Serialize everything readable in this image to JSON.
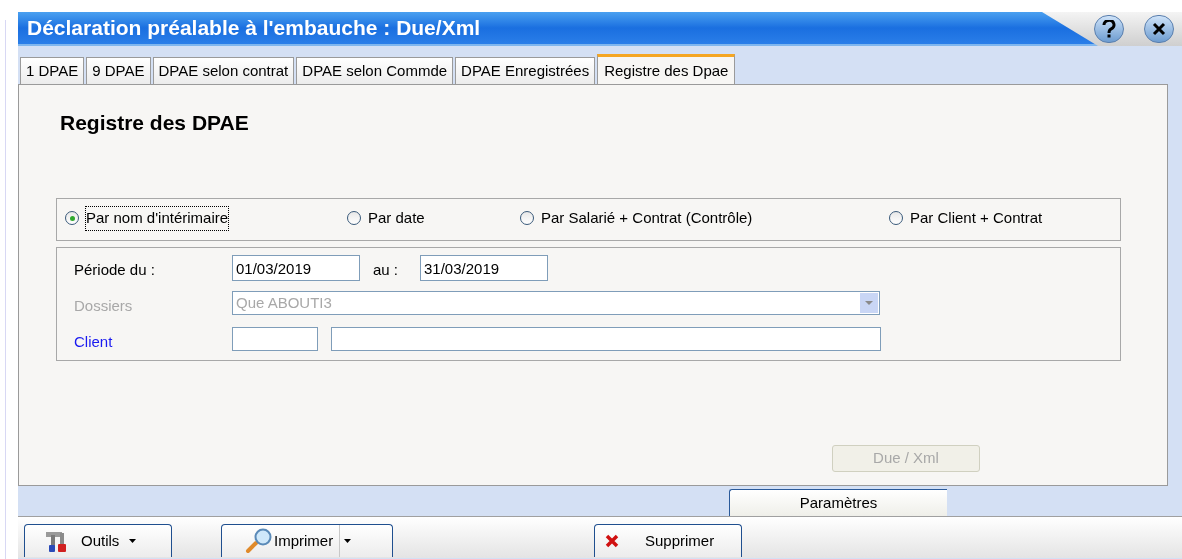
{
  "window": {
    "title": "Déclaration préalable à l'embauche : Due/Xml"
  },
  "tabs": [
    {
      "label": "1 DPAE",
      "selected": false
    },
    {
      "label": "9 DPAE",
      "selected": false
    },
    {
      "label": "DPAE selon contrat",
      "selected": false
    },
    {
      "label": "DPAE selon Commde",
      "selected": false
    },
    {
      "label": "DPAE Enregistrées",
      "selected": false
    },
    {
      "label": "Registre des Dpae",
      "selected": true
    }
  ],
  "heading": "Registre des DPAE",
  "options": [
    {
      "label": "Par nom d'intérimaire",
      "selected": true
    },
    {
      "label": "Par date",
      "selected": false
    },
    {
      "label": "Par Salarié + Contrat (Contrôle)",
      "selected": false
    },
    {
      "label": "Par Client + Contrat",
      "selected": false
    }
  ],
  "period": {
    "label": "Période du :",
    "from": "01/03/2019",
    "to_label": "au :",
    "to": "31/03/2019"
  },
  "dossiers": {
    "label": "Dossiers",
    "value": "Que ABOUTI3",
    "disabled": true
  },
  "client": {
    "label": "Client"
  },
  "due_button": {
    "label": "Due / Xml",
    "disabled": true
  },
  "bottom_tab": "Paramètres",
  "toolbar": [
    {
      "kind": "tools",
      "label": "Outils"
    },
    {
      "kind": "print",
      "label": "Imprimer"
    },
    {
      "kind": "delete",
      "label": "Supprimer"
    }
  ]
}
